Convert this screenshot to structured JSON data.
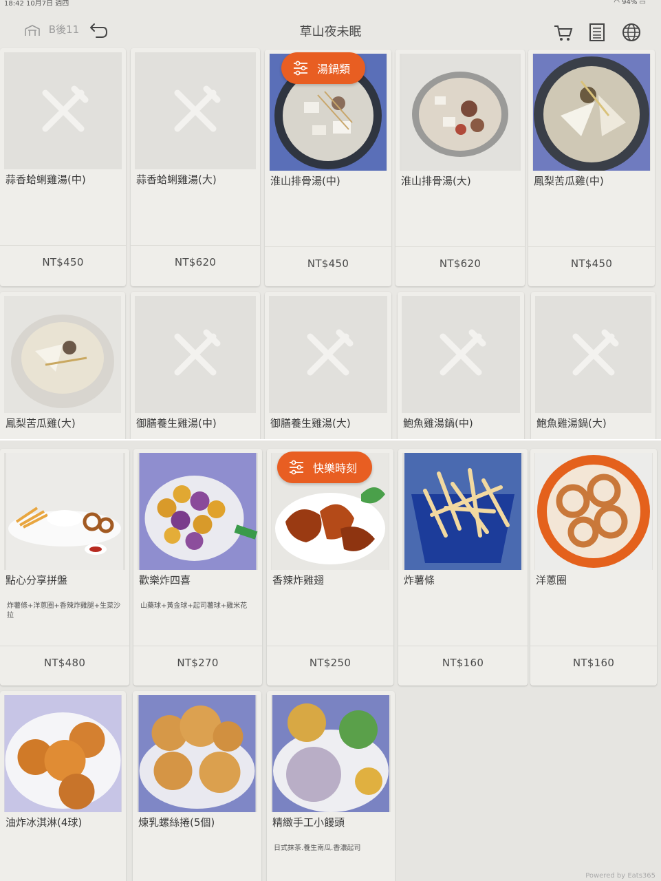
{
  "status": {
    "time": "18:42",
    "date": "10月7日 週四",
    "battery": "94%"
  },
  "header": {
    "table": "B後11",
    "title": "草山夜未眠"
  },
  "icons": {
    "table": "table-icon",
    "back": "back-arrow-icon",
    "cart": "cart-icon",
    "orders": "receipt-icon",
    "language": "globe-icon",
    "placeholder": "fork-knife-icon",
    "filter": "filter-sliders-icon"
  },
  "colors": {
    "accent": "#e85e22",
    "background": "#e9e8e4",
    "card": "#efeeea"
  },
  "top_category": "湯鍋類",
  "top_items": [
    {
      "name": "蒜香蛤蜊雞湯(中)",
      "price": "NT$450"
    },
    {
      "name": "蒜香蛤蜊雞湯(大)",
      "price": "NT$620"
    },
    {
      "name": "淮山排骨湯(中)",
      "price": "NT$450"
    },
    {
      "name": "淮山排骨湯(大)",
      "price": "NT$620"
    },
    {
      "name": "鳳梨苦瓜雞(中)",
      "price": "NT$450"
    },
    {
      "name": "鳳梨苦瓜雞(大)"
    },
    {
      "name": "御膳養生雞湯(中)"
    },
    {
      "name": "御膳養生雞湯(大)"
    },
    {
      "name": "鮑魚雞湯鍋(中)"
    },
    {
      "name": "鮑魚雞湯鍋(大)"
    }
  ],
  "bottom_category": "快樂時刻",
  "bottom_items": [
    {
      "name": "點心分享拼盤",
      "desc": "炸薯條+洋蔥圈+香辣炸雞腿+生菜沙拉",
      "price": "NT$480"
    },
    {
      "name": "歡樂炸四喜",
      "desc": "山藥球+黃金球+起司薯球+雞米花",
      "price": "NT$270"
    },
    {
      "name": "香辣炸雞翅",
      "price": "NT$250"
    },
    {
      "name": "炸薯條",
      "price": "NT$160"
    },
    {
      "name": "洋蔥圈",
      "price": "NT$160"
    },
    {
      "name": "油炸冰淇淋(4球)"
    },
    {
      "name": "煉乳螺絲捲(5個)"
    },
    {
      "name": "精緻手工小饅頭",
      "desc": "日式抹茶.養生南瓜.香濃起司"
    }
  ],
  "footer": {
    "powered": "Powered by Eats365"
  }
}
